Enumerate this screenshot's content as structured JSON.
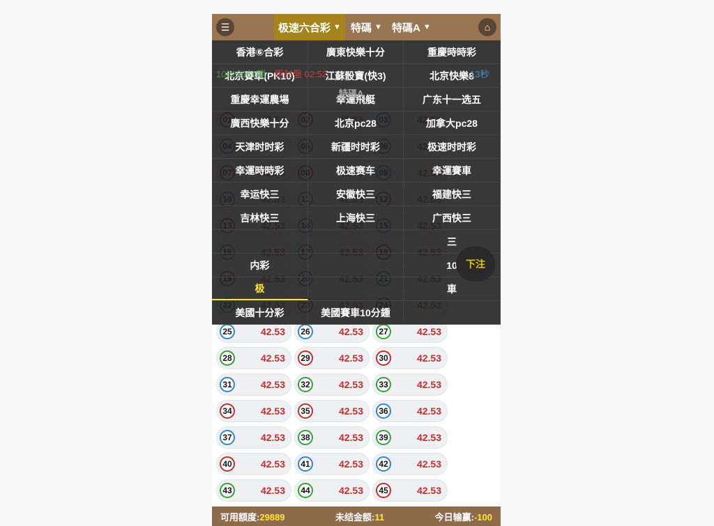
{
  "header": {
    "menu_icon": "list-icon",
    "home_icon": "home-icon",
    "tabs": [
      {
        "label": "极速六合彩",
        "active": true
      },
      {
        "label": "特碼"
      },
      {
        "label": "特碼A"
      }
    ]
  },
  "info": {
    "period": "10823061期",
    "countdown": "距封盤 02:52",
    "seconds": "13秒",
    "section": "特碼A"
  },
  "colors": {
    "header": "#9a7551",
    "active_tab": "#a6841c",
    "red": "#c0302a",
    "blue": "#2f86cf",
    "green": "#2fa534",
    "highlight": "#ffe433"
  },
  "menu": [
    [
      "香港⑥合彩",
      "廣東快樂十分",
      "重慶時時彩"
    ],
    [
      "北京賽車(PK10)",
      "江蘇骰寶(快3)",
      "北京快樂8"
    ],
    [
      "重慶幸運農場",
      "幸運飛艇",
      "广东十一选五"
    ],
    [
      "廣西快樂十分",
      "北京pc28",
      "加拿大pc28"
    ],
    [
      "天津时时彩",
      "新疆时时彩",
      "极速时时彩"
    ],
    [
      "幸運時時彩",
      "极速赛车",
      "幸運賽車"
    ],
    [
      "幸运快三",
      "安徽快三",
      "福建快三"
    ],
    [
      "吉林快三",
      "上海快三",
      "广西快三"
    ],
    [
      "",
      "",
      "三"
    ],
    [
      "内彩",
      "",
      "10"
    ],
    [
      "极",
      "",
      "車"
    ],
    [
      "美國十分彩",
      "美國賽車10分鍾",
      ""
    ]
  ],
  "menu_selected": "极",
  "bet_button": "下注",
  "balls": [
    {
      "n": "01",
      "c": "red",
      "o": "42.53"
    },
    {
      "n": "02",
      "c": "red",
      "o": "42.53"
    },
    {
      "n": "03",
      "c": "blue",
      "o": "42.53"
    },
    {
      "n": "04",
      "c": "blue",
      "o": "42.53"
    },
    {
      "n": "05",
      "c": "green",
      "o": "42.53"
    },
    {
      "n": "06",
      "c": "green",
      "o": "42.53"
    },
    {
      "n": "07",
      "c": "red",
      "o": "42.53"
    },
    {
      "n": "08",
      "c": "red",
      "o": "42.53"
    },
    {
      "n": "09",
      "c": "blue",
      "o": "42.53"
    },
    {
      "n": "10",
      "c": "blue",
      "o": "42.53"
    },
    {
      "n": "11",
      "c": "green",
      "o": "42.53"
    },
    {
      "n": "12",
      "c": "red",
      "o": "42.53"
    },
    {
      "n": "13",
      "c": "red",
      "o": "42.53"
    },
    {
      "n": "14",
      "c": "blue",
      "o": "42.53"
    },
    {
      "n": "15",
      "c": "blue",
      "o": "42.53"
    },
    {
      "n": "16",
      "c": "green",
      "o": "42.53"
    },
    {
      "n": "17",
      "c": "green",
      "o": "42.53"
    },
    {
      "n": "18",
      "c": "red",
      "o": "42.53"
    },
    {
      "n": "19",
      "c": "red",
      "o": "42.53"
    },
    {
      "n": "20",
      "c": "blue",
      "o": "42.53"
    },
    {
      "n": "21",
      "c": "green",
      "o": "42.53"
    },
    {
      "n": "22",
      "c": "green",
      "o": "42.53"
    },
    {
      "n": "23",
      "c": "red",
      "o": "42.53"
    },
    {
      "n": "24",
      "c": "red",
      "o": "42.53"
    },
    {
      "n": "25",
      "c": "blue",
      "o": "42.53"
    },
    {
      "n": "26",
      "c": "blue",
      "o": "42.53"
    },
    {
      "n": "27",
      "c": "green",
      "o": "42.53"
    },
    {
      "n": "28",
      "c": "green",
      "o": "42.53"
    },
    {
      "n": "29",
      "c": "red",
      "o": "42.53"
    },
    {
      "n": "30",
      "c": "red",
      "o": "42.53"
    },
    {
      "n": "31",
      "c": "blue",
      "o": "42.53"
    },
    {
      "n": "32",
      "c": "green",
      "o": "42.53"
    },
    {
      "n": "33",
      "c": "green",
      "o": "42.53"
    },
    {
      "n": "34",
      "c": "red",
      "o": "42.53"
    },
    {
      "n": "35",
      "c": "red",
      "o": "42.53"
    },
    {
      "n": "36",
      "c": "blue",
      "o": "42.53"
    },
    {
      "n": "37",
      "c": "blue",
      "o": "42.53"
    },
    {
      "n": "38",
      "c": "green",
      "o": "42.53"
    },
    {
      "n": "39",
      "c": "green",
      "o": "42.53"
    },
    {
      "n": "40",
      "c": "red",
      "o": "42.53"
    },
    {
      "n": "41",
      "c": "blue",
      "o": "42.53"
    },
    {
      "n": "42",
      "c": "blue",
      "o": "42.53"
    },
    {
      "n": "43",
      "c": "green",
      "o": "42.53"
    },
    {
      "n": "44",
      "c": "green",
      "o": "42.53"
    },
    {
      "n": "45",
      "c": "red",
      "o": "42.53"
    }
  ],
  "footer": {
    "balance_label": "可用額度:",
    "balance": "29889",
    "unsettled_label": "未结金额:",
    "unsettled": "11",
    "today_label": "今日输赢:",
    "today": "-100"
  }
}
